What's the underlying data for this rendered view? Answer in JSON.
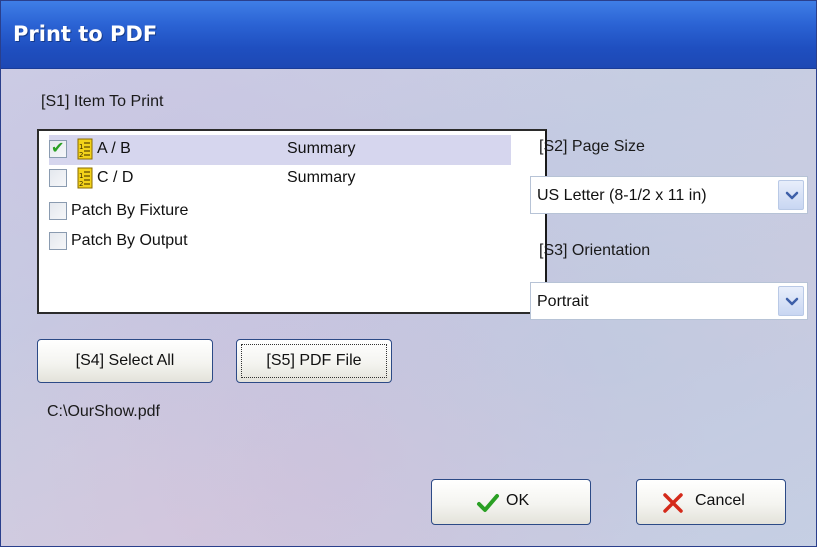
{
  "window": {
    "title": "Print to PDF"
  },
  "items_section": {
    "label": "[S1] Item To Print"
  },
  "items": [
    {
      "name": "A / B",
      "type": "Summary",
      "checked": true,
      "selected": true,
      "icon": "list-icon"
    },
    {
      "name": "C / D",
      "type": "Summary",
      "checked": false,
      "selected": false,
      "icon": "list-icon"
    },
    {
      "name": "Patch By Fixture",
      "type": "",
      "checked": false,
      "selected": false,
      "icon": ""
    },
    {
      "name": "Patch By Output",
      "type": "",
      "checked": false,
      "selected": false,
      "icon": ""
    }
  ],
  "page_size": {
    "label": "[S2] Page Size",
    "value": "US Letter (8-1/2 x 11 in)"
  },
  "orientation": {
    "label": "[S3] Orientation",
    "value": "Portrait"
  },
  "buttons": {
    "select_all": "[S4] Select All",
    "pdf_file": "[S5] PDF File",
    "ok": "OK",
    "cancel": "Cancel"
  },
  "file_path": "C:\\OurShow.pdf",
  "colors": {
    "title_bar": "#2b63d4",
    "check": "#2aa024",
    "cancel_x": "#d42a1a",
    "selection": "#d6d6ee"
  }
}
